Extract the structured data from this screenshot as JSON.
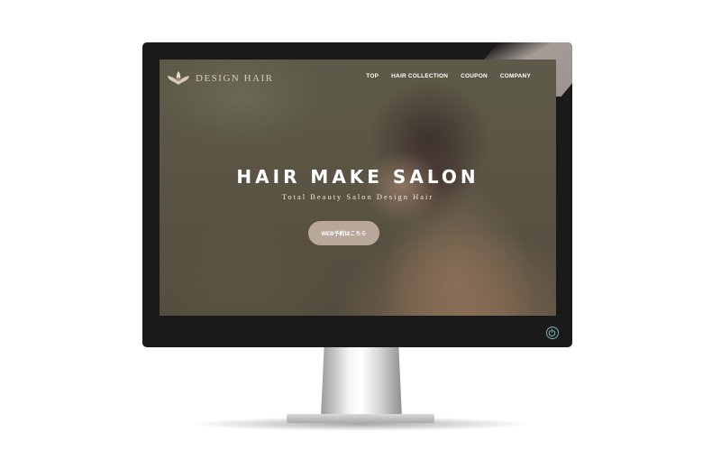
{
  "site": {
    "logo_text": "DESIGN HAIR",
    "nav": [
      {
        "label": "TOP"
      },
      {
        "label": "HAIR COLLECTION"
      },
      {
        "label": "COUPON"
      },
      {
        "label": "COMPANY"
      }
    ]
  },
  "hero": {
    "title": "HAIR MAKE SALON",
    "subtitle": "Total Beauty Salon Design Hair",
    "cta_label": "WEB予約はこちら"
  },
  "colors": {
    "bezel": "#1b1a1a",
    "cta": "#b8a79b",
    "power_led": "#6fb7a8"
  },
  "icons": {
    "logo": "flower-logo-icon",
    "power": "power-icon"
  }
}
